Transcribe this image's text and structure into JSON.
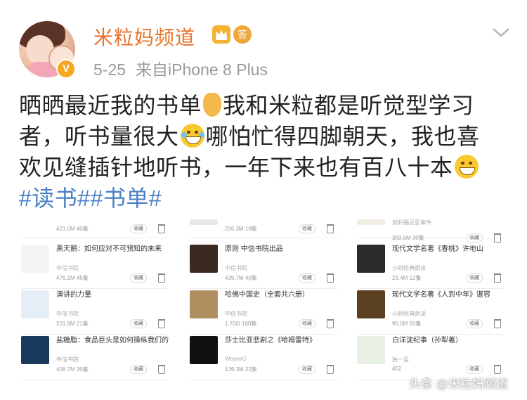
{
  "user": {
    "name": "米粒妈频道",
    "date": "5-25",
    "source": "来自iPhone 8 Plus",
    "verified_badge": "V",
    "medal_text": "答"
  },
  "post": {
    "line1": "晒晒最近我的书单",
    "line1b": "我和米粒都是听觉型学习",
    "line2a": "者，听书量很大",
    "line2b": "哪怕忙得四脚朝天，我也喜",
    "line3": "欢见缝插针地听书，一年下来也有百八十本",
    "hashtags": "#读书##书单#"
  },
  "books": {
    "col1": [
      {
        "title": "",
        "publisher": "",
        "size": "421.0M",
        "episodes": "40集",
        "button": "收藏"
      },
      {
        "title": "黑天鹅：如何应对不可预知的未来",
        "publisher": "中信书院",
        "size": "476.1M",
        "episodes": "45集",
        "button": "收藏"
      },
      {
        "title": "演讲的力量",
        "publisher": "中信书院",
        "size": "231.8M",
        "episodes": "21集",
        "button": "收藏"
      },
      {
        "title": "盐糖脂：食品巨头是如何操纵我们的",
        "publisher": "中信书院",
        "size": "406.7M",
        "episodes": "30集",
        "button": "收藏"
      }
    ],
    "col2": [
      {
        "title": "",
        "publisher": "",
        "size": "226.3M",
        "episodes": "18集",
        "button": "收藏"
      },
      {
        "title": "原则 中信书院出品",
        "publisher": "中信书院",
        "size": "439.7M",
        "episodes": "40集",
        "button": "收藏"
      },
      {
        "title": "哈佛中国史（全套共六册）",
        "publisher": "中信书院",
        "size": "1.70G",
        "episodes": "160集",
        "button": "收藏"
      },
      {
        "title": "莎士比亚悲剧之《哈姆雷特》",
        "publisher": "WayneG",
        "size": "139.3M",
        "episodes": "22集",
        "button": "收藏"
      }
    ],
    "col3": [
      {
        "title": "",
        "publisher": "加利福尼亚事件",
        "size": "359.5M",
        "episodes": "30集",
        "button": "收藏"
      },
      {
        "title": "现代文学名著《春桃》许地山",
        "publisher": "小耕经典朗读",
        "size": "23.4M",
        "episodes": "12集",
        "button": "收藏"
      },
      {
        "title": "现代文学名著《人到中年》谌容",
        "publisher": "小耕经典朗读",
        "size": "95.0M",
        "episodes": "50集",
        "button": "收藏"
      },
      {
        "title": "白洋淀纪事（孙犁著）",
        "publisher": "独一蓝",
        "size": "452",
        "episodes": "",
        "button": "收藏"
      }
    ]
  },
  "watermark": "头条 @米粒妈频道",
  "colors": {
    "username": "#e8742c",
    "hashtag": "#4a80c6",
    "meta": "#9a9a9a"
  }
}
